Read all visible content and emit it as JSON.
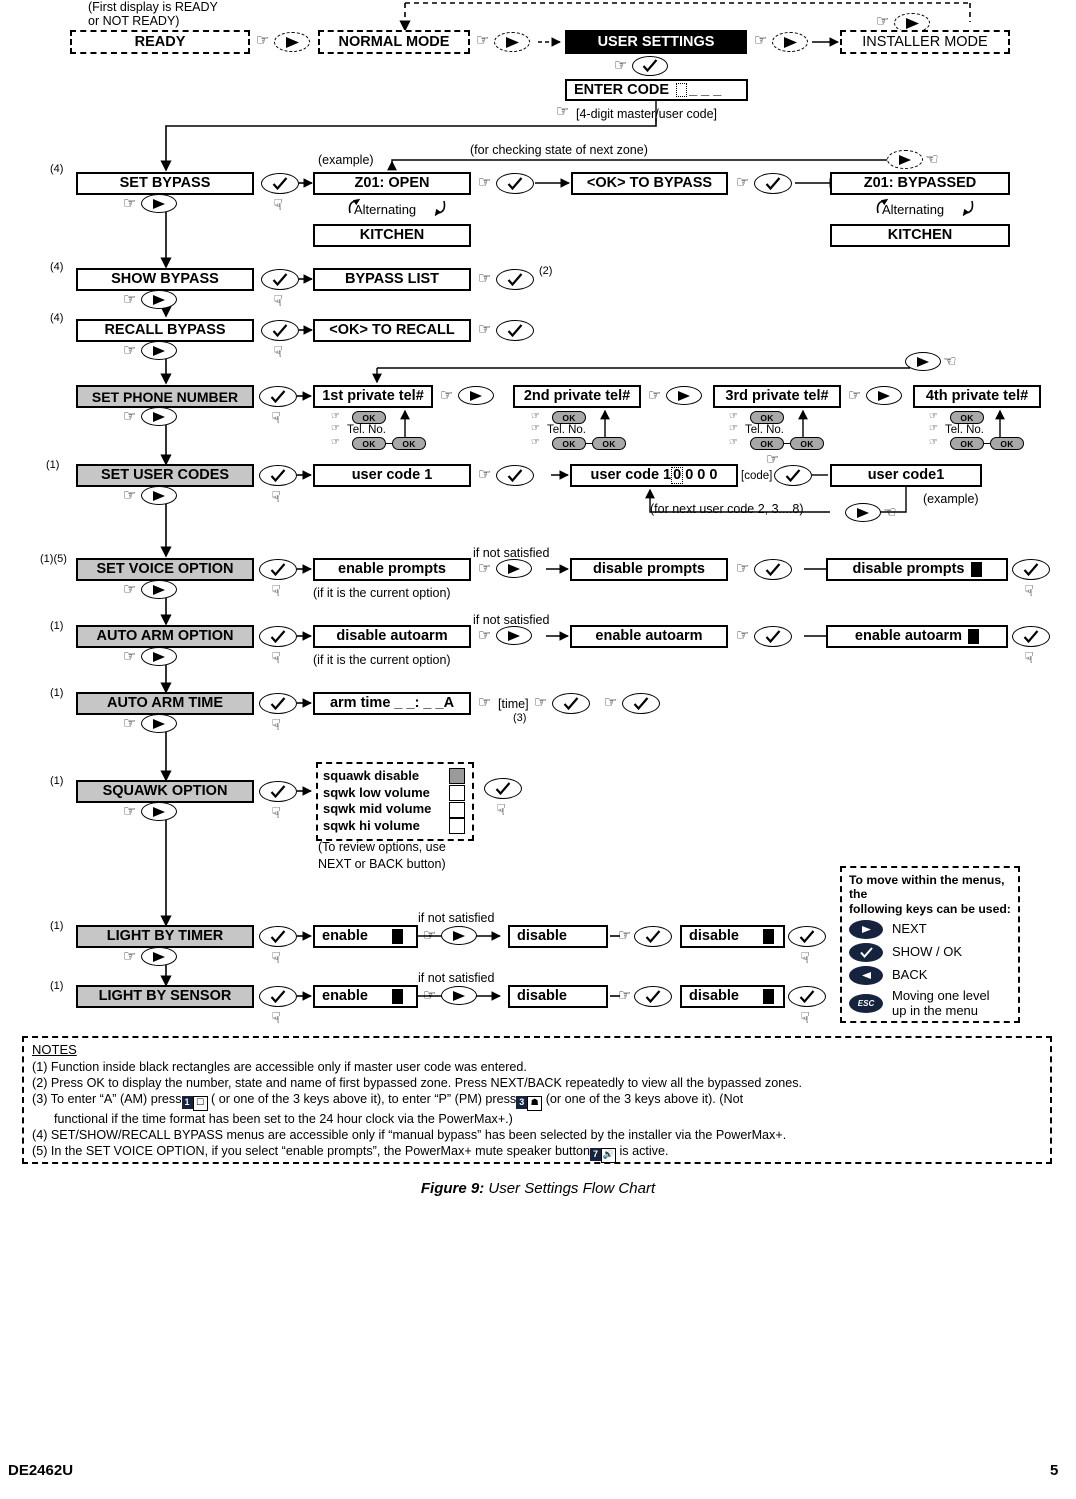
{
  "document": {
    "caption_label": "Figure 9:",
    "caption_text": " User Settings Flow Chart",
    "footer_doc_id": "DE2462U",
    "footer_page": "5"
  },
  "top_row": {
    "first_display_note_line1": "(First display is READY",
    "first_display_note_line2": "or NOT READY)",
    "ready": "READY",
    "normal_mode": "NORMAL MODE",
    "user_settings": "USER SETTINGS",
    "installer_mode": "INSTALLER MODE",
    "enter_code": "ENTER CODE",
    "enter_code_digits": "_ _ _",
    "enter_code_hint": "[4-digit master/user code]"
  },
  "menus": [
    {
      "id": "set-bypass",
      "label": "SET BYPASS",
      "note": "(4)",
      "fill": "white"
    },
    {
      "id": "show-bypass",
      "label": "SHOW BYPASS",
      "note": "(4)",
      "fill": "white"
    },
    {
      "id": "recall-bypass",
      "label": "RECALL BYPASS",
      "note": "(4)",
      "fill": "white"
    },
    {
      "id": "set-phone-number",
      "label": "SET PHONE NUMBER",
      "note": "",
      "fill": "gray"
    },
    {
      "id": "set-user-codes",
      "label": "SET USER CODES",
      "note": "(1)",
      "fill": "gray"
    },
    {
      "id": "set-voice-option",
      "label": "SET VOICE OPTION",
      "note": "(1)(5)",
      "fill": "gray"
    },
    {
      "id": "auto-arm-option",
      "label": "AUTO ARM OPTION",
      "note": "(1)",
      "fill": "gray"
    },
    {
      "id": "auto-arm-time",
      "label": "AUTO ARM TIME",
      "note": "(1)",
      "fill": "gray"
    },
    {
      "id": "squawk-option",
      "label": "SQUAWK OPTION",
      "note": "(1)",
      "fill": "gray"
    },
    {
      "id": "light-by-timer",
      "label": "LIGHT BY TIMER",
      "note": "(1)",
      "fill": "gray"
    },
    {
      "id": "light-by-sensor",
      "label": "LIGHT BY SENSOR",
      "note": "(1)",
      "fill": "gray"
    }
  ],
  "set_bypass_row": {
    "example_label": "(example)",
    "check_next_zone": "(for checking state of next zone)",
    "zone_open": "Z01: OPEN",
    "alternating": "Alternating",
    "zone_name": "KITCHEN",
    "ok_to_bypass": "<OK> TO BYPASS",
    "zone_bypassed": "Z01: BYPASSED",
    "zone_name_2": "KITCHEN"
  },
  "show_bypass_row": {
    "bypass_list": "BYPASS LIST",
    "note": "(2)"
  },
  "recall_bypass_row": {
    "ok_to_recall": "<OK> TO RECALL"
  },
  "phone_row": {
    "entries": [
      {
        "label": "1st private tel#"
      },
      {
        "label": "2nd private tel#"
      },
      {
        "label": "3rd private tel#"
      },
      {
        "label": "4th private tel#"
      }
    ],
    "ok_label": "OK",
    "tel_no_label": "Tel. No."
  },
  "user_codes_row": {
    "user_code_1": "user code 1",
    "user_code_digits_prefix": "user code 1 ",
    "user_code_digits_first": "0",
    "user_code_digits_rest": "0 0 0",
    "code_hint": "[code]",
    "user_code_result": "user code1",
    "example_label": "(example)",
    "next_user_code": "(for next user code 2, 3....8)"
  },
  "voice_row": {
    "enable_prompts": "enable prompts",
    "current_option_hint": "(if it is the current option)",
    "if_not_satisfied": "if not satisfied",
    "disable_prompts": "disable prompts",
    "disable_prompts_confirm": "disable prompts"
  },
  "autoarm_row": {
    "disable_autoarm": "disable autoarm",
    "current_option_hint": "(if it is the current option)",
    "if_not_satisfied": "if not satisfied",
    "enable_autoarm": "enable autoarm",
    "enable_autoarm_confirm": "enable autoarm"
  },
  "autoarm_time_row": {
    "arm_time": "arm time _ _: _ _A",
    "time_hint": "[time]",
    "note": "(3)"
  },
  "squawk_row": {
    "options": [
      {
        "label": "squawk disable",
        "checked": true
      },
      {
        "label": "sqwk low volume",
        "checked": false
      },
      {
        "label": "sqwk mid volume",
        "checked": false
      },
      {
        "label": "sqwk hi volume",
        "checked": false
      }
    ],
    "review_hint_line1": "(To review options, use",
    "review_hint_line2": "NEXT or BACK button)"
  },
  "light_timer_row": {
    "if_not_satisfied": "if not satisfied",
    "enable": "enable",
    "disable": "disable",
    "disable_confirm": "disable"
  },
  "light_sensor_row": {
    "if_not_satisfied": "if not satisfied",
    "enable": "enable",
    "disable": "disable",
    "disable_confirm": "disable"
  },
  "legend": {
    "head_line1": "To move within the menus, the",
    "head_line2": "following keys can be used:",
    "items": [
      {
        "icon": "next-icon",
        "label": "NEXT"
      },
      {
        "icon": "ok-icon",
        "label": "SHOW / OK"
      },
      {
        "icon": "back-icon",
        "label": "BACK"
      },
      {
        "icon": "esc-icon",
        "label": "Moving one level\nup in the menu",
        "esc_text": "ESC"
      }
    ]
  },
  "notes": {
    "title": "NOTES",
    "n1": "(1) Function inside black rectangles are accessible only if master user code was entered.",
    "n2": "(2) Press OK to display the number, state and name of first bypassed zone. Press NEXT/BACK repeatedly to view all the bypassed zones.",
    "n3a": "(3) To enter “A” (AM) press",
    "n3b": "( or one of the 3 keys above it), to enter “P” (PM) press",
    "n3c": "(or one of the 3 keys above it). (Not",
    "n3d": "functional if the time format has been set to the 24 hour clock via the PowerMax+.)",
    "n3_key1": "1",
    "n3_key2": "3",
    "n4": "(4) SET/SHOW/RECALL BYPASS menus are accessible only if “manual bypass” has been selected by the installer via the PowerMax+.",
    "n5a": "(5) In the SET VOICE OPTION, if you select “enable prompts”, the PowerMax+ mute speaker button",
    "n5b": "is active.",
    "n5_key": "7"
  },
  "colors": {
    "gray_fill": "#c6c6c6",
    "black_fill": "#000000",
    "legend_key": "#16233f",
    "ok_pill": "#a8a8a8"
  }
}
